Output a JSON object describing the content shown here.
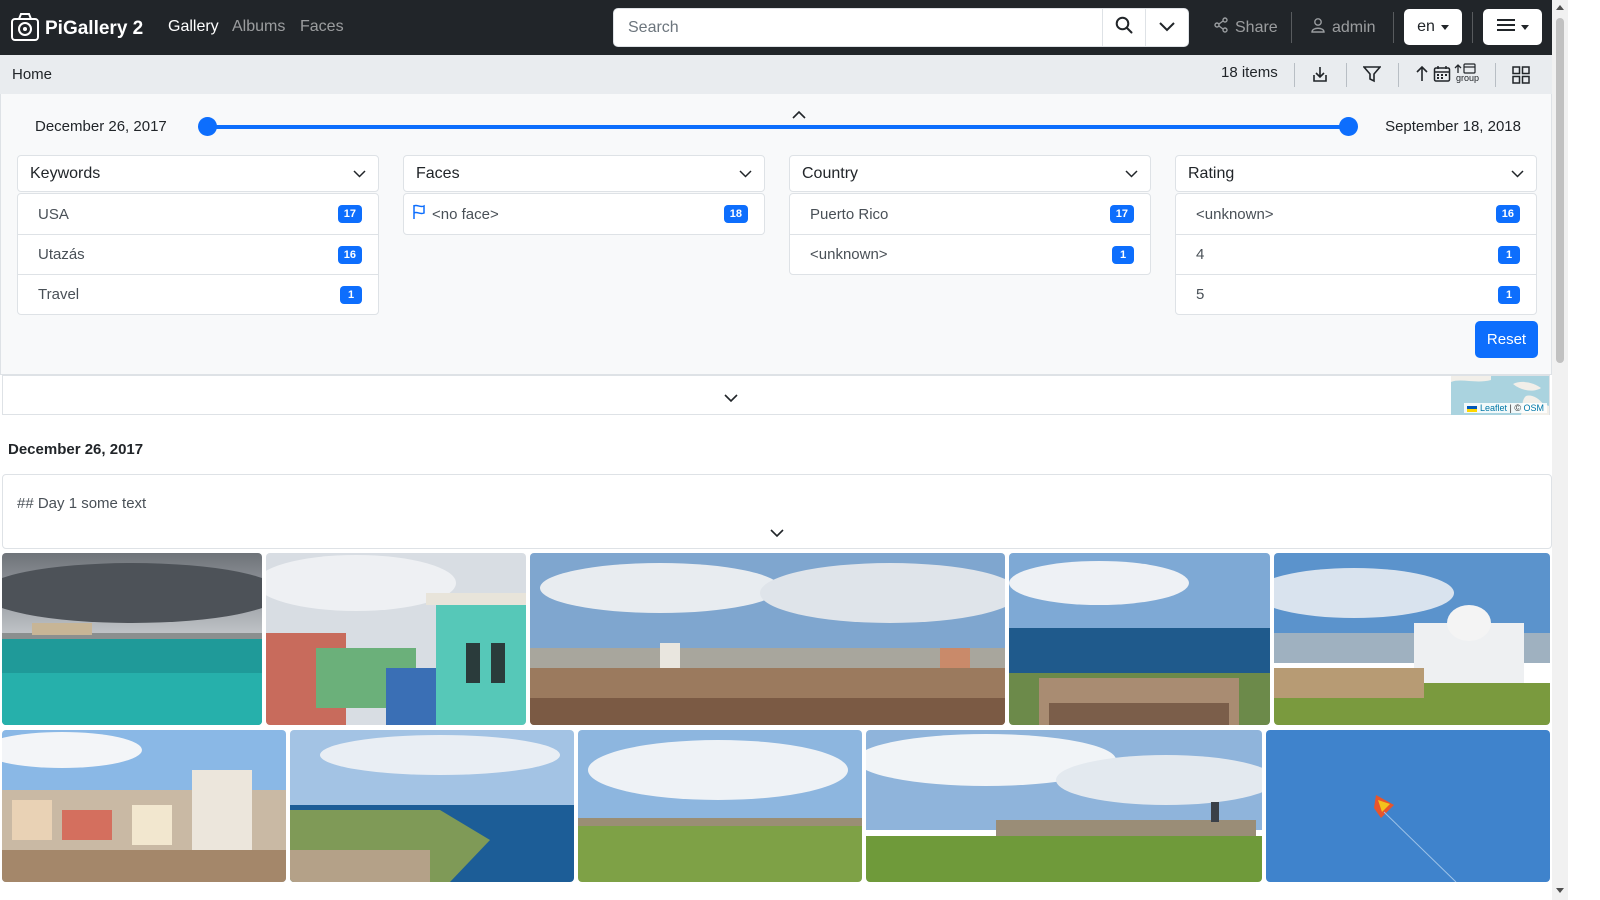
{
  "app": {
    "title": "PiGallery 2"
  },
  "nav": {
    "links": [
      "Gallery",
      "Albums",
      "Faces"
    ],
    "active": "Gallery"
  },
  "search": {
    "placeholder": "Search",
    "value": ""
  },
  "header_actions": {
    "share_label": "Share",
    "user_label": "admin",
    "language": "en"
  },
  "breadcrumb": {
    "home": "Home"
  },
  "toolbar": {
    "items_count": "18 items",
    "group_label": "group"
  },
  "date_filter": {
    "start": "December 26, 2017",
    "end": "September 18, 2018",
    "range_selected": [
      0,
      1
    ]
  },
  "filters": [
    {
      "title": "Keywords",
      "items": [
        {
          "label": "USA",
          "count": "17"
        },
        {
          "label": "Utazás",
          "count": "16"
        },
        {
          "label": "Travel",
          "count": "1"
        }
      ]
    },
    {
      "title": "Faces",
      "items": [
        {
          "label": "<no face>",
          "count": "18"
        }
      ]
    },
    {
      "title": "Country",
      "items": [
        {
          "label": "Puerto Rico",
          "count": "17"
        },
        {
          "label": "<unknown>",
          "count": "1"
        }
      ]
    },
    {
      "title": "Rating",
      "items": [
        {
          "label": "<unknown>",
          "count": "16"
        },
        {
          "label": "4",
          "count": "1"
        },
        {
          "label": "5",
          "count": "1"
        }
      ]
    }
  ],
  "reset_label": "Reset",
  "map": {
    "attribution_leaflet": "Leaflet",
    "attribution_sep": " | © ",
    "attribution_osm": "OSM"
  },
  "gallery": {
    "date_heading": "December 26, 2017",
    "note_text": "## Day 1 some text"
  },
  "colors": {
    "navbar": "#212529",
    "accent": "#0d6efd",
    "panel": "#f8f9fa",
    "crumbbar": "#e9ecef"
  }
}
